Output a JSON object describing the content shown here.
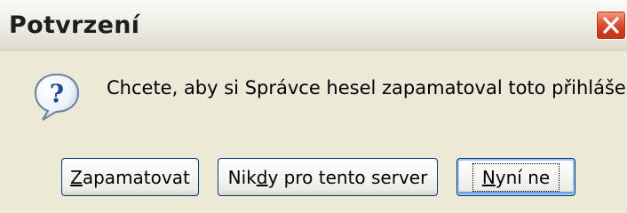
{
  "dialog": {
    "title": "Potvrzení",
    "message": "Chcete, aby si Správce hesel zapamatoval toto přihlášení?",
    "icon": "question-icon"
  },
  "buttons": {
    "remember": {
      "prefix": "",
      "mnemonic": "Z",
      "suffix": "apamatovat"
    },
    "never": {
      "prefix": "Nik",
      "mnemonic": "d",
      "suffix": "y pro tento server"
    },
    "not_now": {
      "prefix": "",
      "mnemonic": "N",
      "suffix": "yní ne"
    }
  },
  "colors": {
    "window_bg": "#ece9d8",
    "close_button": "#cf3b1c",
    "button_border": "#003c74",
    "focus_ring": "#99c6f2"
  }
}
